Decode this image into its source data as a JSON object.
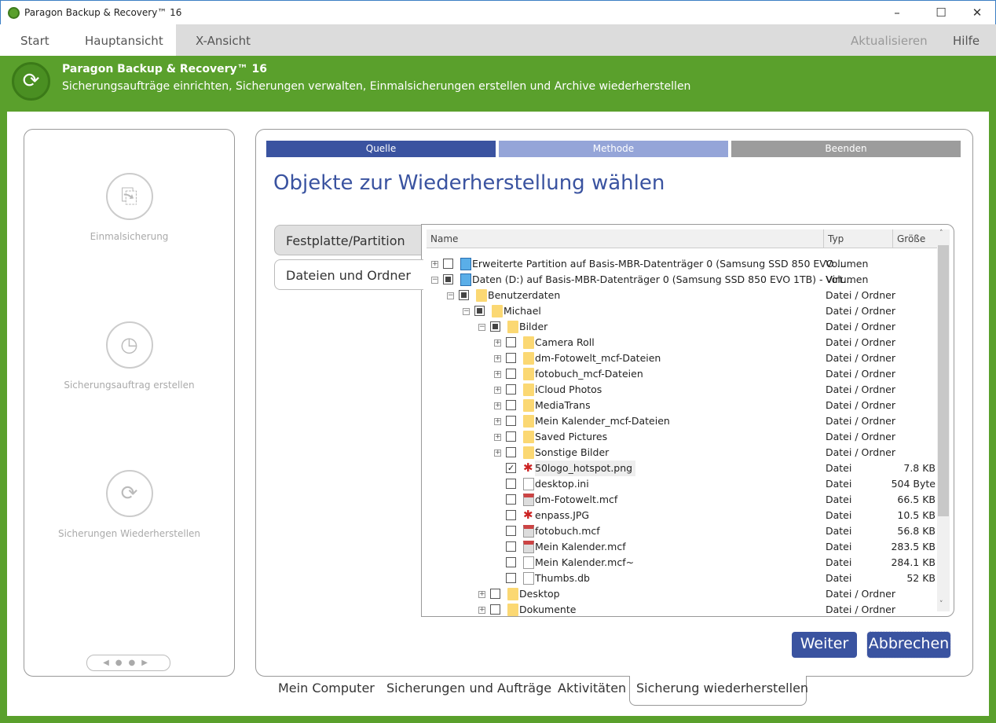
{
  "window": {
    "title": "Paragon Backup & Recovery™ 16",
    "minimize": "–",
    "maximize": "☐",
    "close": "✕"
  },
  "menu": {
    "start": "Start",
    "haupt": "Hauptansicht",
    "x": "X-Ansicht",
    "refresh": "Aktualisieren",
    "help": "Hilfe"
  },
  "banner": {
    "title": "Paragon Backup & Recovery™ 16",
    "subtitle": "Sicherungsaufträge einrichten, Sicherungen verwalten, Einmalsicherungen erstellen und Archive wiederherstellen"
  },
  "sidebar": {
    "items": [
      {
        "label": "Einmalsicherung"
      },
      {
        "label": "Sicherungsauftrag erstellen"
      },
      {
        "label": "Sicherungen Wiederherstellen"
      }
    ]
  },
  "steps": [
    {
      "label": "Quelle",
      "color": "#3a53a0"
    },
    {
      "label": "Methode",
      "color": "#95a5d8"
    },
    {
      "label": "Beenden",
      "color": "#9c9c9c"
    }
  ],
  "page_title": "Objekte zur Wiederherstellung wählen",
  "source_tabs": [
    {
      "label": "Festplatte/Partition"
    },
    {
      "label": "Dateien und Ordner"
    }
  ],
  "tree": {
    "columns": {
      "name": "Name",
      "type": "Typ",
      "size": "Größe"
    },
    "rows": [
      {
        "name": "Erweiterte Partition auf Basis-MBR-Datenträger 0 (Samsung SSD 850 EVO ...",
        "type": "Volumen",
        "size": "",
        "level": 0,
        "exp": "+",
        "check": "empty",
        "icon": "drive"
      },
      {
        "name": "Daten (D:) auf Basis-MBR-Datenträger 0 (Samsung SSD 850 EVO 1TB) - Virt...",
        "type": "Volumen",
        "size": "",
        "level": 0,
        "exp": "-",
        "check": "partial",
        "icon": "drive"
      },
      {
        "name": "Benutzerdaten",
        "type": "Datei / Ordner",
        "size": "",
        "level": 1,
        "exp": "-",
        "check": "partial",
        "icon": "folder"
      },
      {
        "name": "Michael",
        "type": "Datei / Ordner",
        "size": "",
        "level": 2,
        "exp": "-",
        "check": "partial",
        "icon": "folder"
      },
      {
        "name": "Bilder",
        "type": "Datei / Ordner",
        "size": "",
        "level": 3,
        "exp": "-",
        "check": "partial",
        "icon": "folder"
      },
      {
        "name": "Camera Roll",
        "type": "Datei / Ordner",
        "size": "",
        "level": 4,
        "exp": "+",
        "check": "empty",
        "icon": "folder"
      },
      {
        "name": "dm-Fotowelt_mcf-Dateien",
        "type": "Datei / Ordner",
        "size": "",
        "level": 4,
        "exp": "+",
        "check": "empty",
        "icon": "folder"
      },
      {
        "name": "fotobuch_mcf-Dateien",
        "type": "Datei / Ordner",
        "size": "",
        "level": 4,
        "exp": "+",
        "check": "empty",
        "icon": "folder"
      },
      {
        "name": "iCloud Photos",
        "type": "Datei / Ordner",
        "size": "",
        "level": 4,
        "exp": "+",
        "check": "empty",
        "icon": "folder"
      },
      {
        "name": "MediaTrans",
        "type": "Datei / Ordner",
        "size": "",
        "level": 4,
        "exp": "+",
        "check": "empty",
        "icon": "folder"
      },
      {
        "name": "Mein Kalender_mcf-Dateien",
        "type": "Datei / Ordner",
        "size": "",
        "level": 4,
        "exp": "+",
        "check": "empty",
        "icon": "folder"
      },
      {
        "name": "Saved Pictures",
        "type": "Datei / Ordner",
        "size": "",
        "level": 4,
        "exp": "+",
        "check": "empty",
        "icon": "folder"
      },
      {
        "name": "Sonstige Bilder",
        "type": "Datei / Ordner",
        "size": "",
        "level": 4,
        "exp": "+",
        "check": "empty",
        "icon": "folder"
      },
      {
        "name": "50logo_hotspot.png",
        "type": "Datei",
        "size": "7.8 KB",
        "level": 4,
        "exp": "",
        "check": "checked",
        "icon": "image",
        "selected": true
      },
      {
        "name": "desktop.ini",
        "type": "Datei",
        "size": "504 Byte",
        "level": 4,
        "exp": "",
        "check": "empty",
        "icon": "file"
      },
      {
        "name": "dm-Fotowelt.mcf",
        "type": "Datei",
        "size": "66.5 KB",
        "level": 4,
        "exp": "",
        "check": "empty",
        "icon": "mcf"
      },
      {
        "name": "enpass.JPG",
        "type": "Datei",
        "size": "10.5 KB",
        "level": 4,
        "exp": "",
        "check": "empty",
        "icon": "image"
      },
      {
        "name": "fotobuch.mcf",
        "type": "Datei",
        "size": "56.8 KB",
        "level": 4,
        "exp": "",
        "check": "empty",
        "icon": "mcf"
      },
      {
        "name": "Mein Kalender.mcf",
        "type": "Datei",
        "size": "283.5 KB",
        "level": 4,
        "exp": "",
        "check": "empty",
        "icon": "mcf"
      },
      {
        "name": "Mein Kalender.mcf~",
        "type": "Datei",
        "size": "284.1 KB",
        "level": 4,
        "exp": "",
        "check": "empty",
        "icon": "file"
      },
      {
        "name": "Thumbs.db",
        "type": "Datei",
        "size": "52 KB",
        "level": 4,
        "exp": "",
        "check": "empty",
        "icon": "file"
      },
      {
        "name": "Desktop",
        "type": "Datei / Ordner",
        "size": "",
        "level": 3,
        "exp": "+",
        "check": "empty",
        "icon": "folder"
      },
      {
        "name": "Dokumente",
        "type": "Datei / Ordner",
        "size": "",
        "level": 3,
        "exp": "+",
        "check": "empty",
        "icon": "folder"
      }
    ]
  },
  "buttons": {
    "next": "Weiter >",
    "cancel": "Abbrechen"
  },
  "bottom_tabs": [
    {
      "label": "Mein Computer"
    },
    {
      "label": "Sicherungen und Aufträge"
    },
    {
      "label": "Aktivitäten"
    },
    {
      "label": "Sicherung wiederherstellen"
    }
  ]
}
